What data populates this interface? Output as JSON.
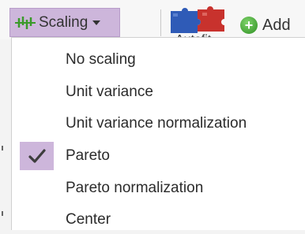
{
  "toolbar": {
    "scaling_label": "Scaling",
    "autofit_label": "Autofit",
    "add_label": "Add"
  },
  "menu": {
    "items": [
      {
        "label": "No scaling",
        "checked": false
      },
      {
        "label": "Unit variance",
        "checked": false
      },
      {
        "label": "Unit variance normalization",
        "checked": false
      },
      {
        "label": "Pareto",
        "checked": true
      },
      {
        "label": "Pareto normalization",
        "checked": false
      },
      {
        "label": "Center",
        "checked": false
      }
    ]
  },
  "icons": {
    "scaling": "scaling-icon",
    "caret": "chevron-down-icon",
    "autofit": "puzzle-icon",
    "add": "plus-circle-icon",
    "check": "check-icon"
  },
  "colors": {
    "highlight": "#cdb6db",
    "scaling_icon_green": "#3a9a2a",
    "puzzle_blue": "#2f5bb7",
    "puzzle_red": "#c8322d",
    "add_green": "#2e8f22"
  }
}
